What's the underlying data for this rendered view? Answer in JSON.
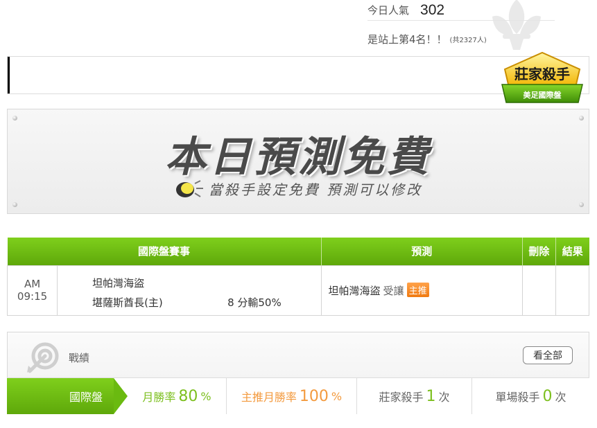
{
  "popularity": {
    "label": "今日人氣",
    "count": "302",
    "rank_text": "是站上第4名！！",
    "rank_total": "(共2327人)"
  },
  "badge": {
    "title": "莊家殺手",
    "subtitle": "美足國際盤"
  },
  "banner": {
    "title": "本日預測免費",
    "subtitle": "當殺手設定免費 預測可以修改"
  },
  "prediction_table": {
    "headers": {
      "match": "國際盤賽事",
      "prediction": "預測",
      "delete": "刪除",
      "result": "結果"
    },
    "rows": [
      {
        "time": "AM 09:15",
        "team_away": "坦帕灣海盜",
        "team_home": "堪薩斯酋長(主)",
        "handicap": "8 分輸50%",
        "pick_team": "坦帕灣海盜",
        "pick_type": "受讓",
        "tag": "主推"
      }
    ]
  },
  "record": {
    "title": "戰績",
    "view_all": "看全部",
    "tab": "國際盤",
    "stats": {
      "monthly_label": "月勝率",
      "monthly_value": "80",
      "monthly_unit": "%",
      "main_label": "主推月勝率",
      "main_value": "100",
      "main_unit": "%",
      "banker_label": "莊家殺手",
      "banker_value": "1",
      "banker_unit": "次",
      "single_label": "單場殺手",
      "single_value": "0",
      "single_unit": "次"
    }
  },
  "colors": {
    "accent_green": "#6aba10",
    "accent_orange": "#f39a3e"
  }
}
